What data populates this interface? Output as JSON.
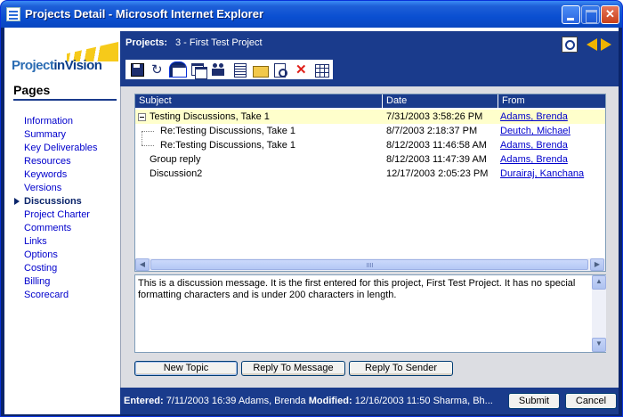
{
  "window": {
    "title": "Projects Detail - Microsoft Internet Explorer"
  },
  "logo": {
    "text_a": "Project",
    "text_b": "inVision"
  },
  "sidebar": {
    "title": "Pages",
    "items": [
      {
        "label": "Information"
      },
      {
        "label": "Summary"
      },
      {
        "label": "Key Deliverables"
      },
      {
        "label": "Resources"
      },
      {
        "label": "Keywords"
      },
      {
        "label": "Versions"
      },
      {
        "label": "Discussions",
        "active": true
      },
      {
        "label": "Project Charter"
      },
      {
        "label": "Comments"
      },
      {
        "label": "Links"
      },
      {
        "label": "Options"
      },
      {
        "label": "Costing"
      },
      {
        "label": "Billing"
      },
      {
        "label": "Scorecard"
      }
    ]
  },
  "header": {
    "label": "Projects:",
    "value": "3 - First Test Project"
  },
  "toolbar": {
    "icons": [
      "save-icon",
      "refresh-icon",
      "window-icon",
      "windows-icon",
      "people-icon",
      "report-icon",
      "folder-icon",
      "preview-icon",
      "delete-icon",
      "grid-icon"
    ]
  },
  "discussions": {
    "columns": {
      "subject": "Subject",
      "date": "Date",
      "from": "From"
    },
    "rows": [
      {
        "subject": "Testing Discussions, Take 1",
        "date": "7/31/2003 3:58:26 PM",
        "from": "Adams, Brenda"
      },
      {
        "subject": "Re:Testing Discussions, Take 1",
        "date": "8/7/2003 2:18:37 PM",
        "from": "Deutch, Michael"
      },
      {
        "subject": "Re:Testing Discussions, Take 1",
        "date": "8/12/2003 11:46:58 AM",
        "from": "Adams, Brenda"
      },
      {
        "subject": "Group reply",
        "date": "8/12/2003 11:47:39 AM",
        "from": "Adams, Brenda"
      },
      {
        "subject": "Discussion2",
        "date": "12/17/2003 2:05:23 PM",
        "from": "Durairaj, Kanchana"
      }
    ]
  },
  "message": {
    "text": "This is a discussion message.  It is the first entered for this project, First Test Project. It has no special formatting characters and is under 200 characters in length."
  },
  "buttons": {
    "new_topic": "New Topic",
    "reply_message": "Reply To Message",
    "reply_sender": "Reply To Sender"
  },
  "status": {
    "entered_label": "Entered:",
    "entered_value": "7/11/2003 16:39 Adams, Brenda",
    "modified_label": "Modified:",
    "modified_value": "12/16/2003 11:50 Sharma, Bh...",
    "submit": "Submit",
    "cancel": "Cancel"
  },
  "colors": {
    "accent": "#1a3b8c",
    "link": "#0000cc",
    "selected_row": "#ffffcc"
  }
}
